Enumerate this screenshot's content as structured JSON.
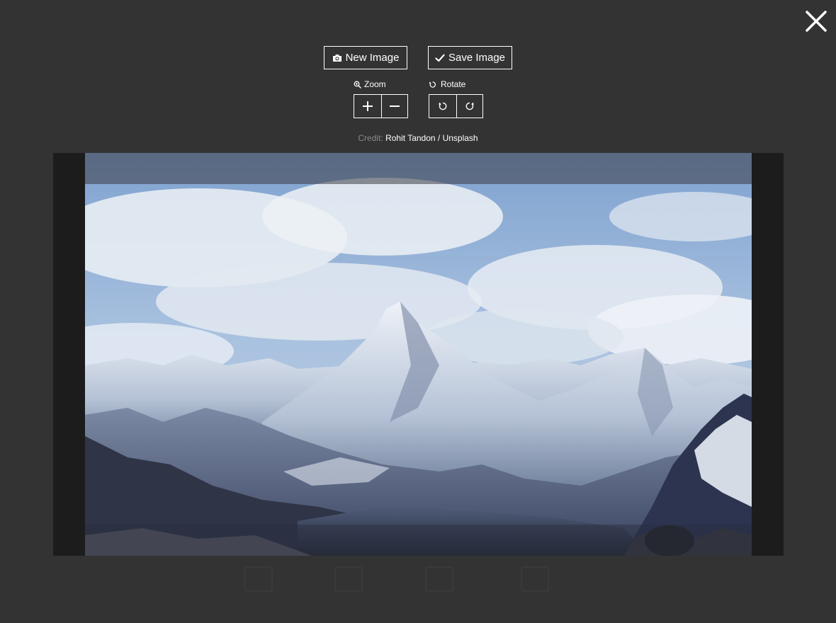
{
  "toolbar": {
    "new_image_label": "New Image",
    "new_image_icon": "camera-icon",
    "save_image_label": "Save Image",
    "save_image_icon": "check-icon"
  },
  "zoom": {
    "label": "Zoom",
    "icon": "zoom-icon",
    "in_icon": "plus-icon",
    "out_icon": "minus-icon"
  },
  "rotate": {
    "label": "Rotate",
    "icon": "rotate-icon",
    "left_icon": "rotate-left-icon",
    "right_icon": "rotate-right-icon"
  },
  "credit": {
    "prefix": "Credit:",
    "name": "Rohit Tandon / Unsplash"
  },
  "close_icon": "close-icon",
  "colors": {
    "background": "#333333",
    "editor_background": "#1c1c1c",
    "text": "#ffffff",
    "credit_prefix": "#8a8a8a"
  }
}
